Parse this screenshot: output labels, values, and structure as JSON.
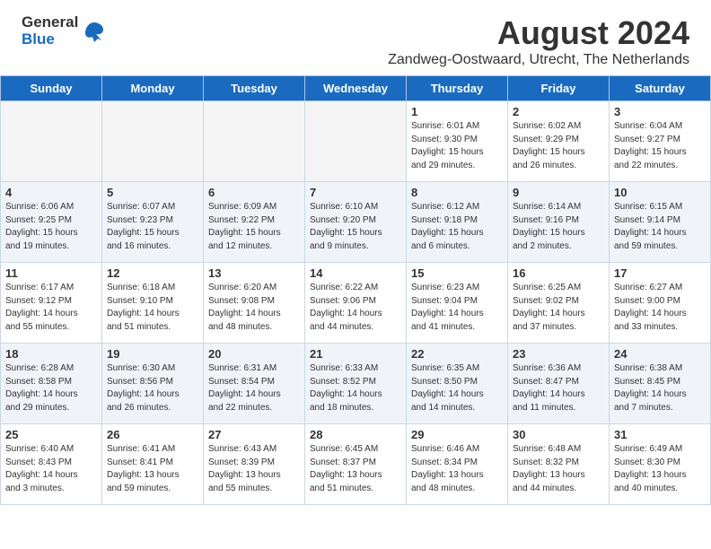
{
  "logo": {
    "general": "General",
    "blue": "Blue"
  },
  "title": "August 2024",
  "subtitle": "Zandweg-Oostwaard, Utrecht, The Netherlands",
  "weekdays": [
    "Sunday",
    "Monday",
    "Tuesday",
    "Wednesday",
    "Thursday",
    "Friday",
    "Saturday"
  ],
  "weeks": [
    [
      {
        "day": "",
        "info": ""
      },
      {
        "day": "",
        "info": ""
      },
      {
        "day": "",
        "info": ""
      },
      {
        "day": "",
        "info": ""
      },
      {
        "day": "1",
        "info": "Sunrise: 6:01 AM\nSunset: 9:30 PM\nDaylight: 15 hours\nand 29 minutes."
      },
      {
        "day": "2",
        "info": "Sunrise: 6:02 AM\nSunset: 9:29 PM\nDaylight: 15 hours\nand 26 minutes."
      },
      {
        "day": "3",
        "info": "Sunrise: 6:04 AM\nSunset: 9:27 PM\nDaylight: 15 hours\nand 22 minutes."
      }
    ],
    [
      {
        "day": "4",
        "info": "Sunrise: 6:06 AM\nSunset: 9:25 PM\nDaylight: 15 hours\nand 19 minutes."
      },
      {
        "day": "5",
        "info": "Sunrise: 6:07 AM\nSunset: 9:23 PM\nDaylight: 15 hours\nand 16 minutes."
      },
      {
        "day": "6",
        "info": "Sunrise: 6:09 AM\nSunset: 9:22 PM\nDaylight: 15 hours\nand 12 minutes."
      },
      {
        "day": "7",
        "info": "Sunrise: 6:10 AM\nSunset: 9:20 PM\nDaylight: 15 hours\nand 9 minutes."
      },
      {
        "day": "8",
        "info": "Sunrise: 6:12 AM\nSunset: 9:18 PM\nDaylight: 15 hours\nand 6 minutes."
      },
      {
        "day": "9",
        "info": "Sunrise: 6:14 AM\nSunset: 9:16 PM\nDaylight: 15 hours\nand 2 minutes."
      },
      {
        "day": "10",
        "info": "Sunrise: 6:15 AM\nSunset: 9:14 PM\nDaylight: 14 hours\nand 59 minutes."
      }
    ],
    [
      {
        "day": "11",
        "info": "Sunrise: 6:17 AM\nSunset: 9:12 PM\nDaylight: 14 hours\nand 55 minutes."
      },
      {
        "day": "12",
        "info": "Sunrise: 6:18 AM\nSunset: 9:10 PM\nDaylight: 14 hours\nand 51 minutes."
      },
      {
        "day": "13",
        "info": "Sunrise: 6:20 AM\nSunset: 9:08 PM\nDaylight: 14 hours\nand 48 minutes."
      },
      {
        "day": "14",
        "info": "Sunrise: 6:22 AM\nSunset: 9:06 PM\nDaylight: 14 hours\nand 44 minutes."
      },
      {
        "day": "15",
        "info": "Sunrise: 6:23 AM\nSunset: 9:04 PM\nDaylight: 14 hours\nand 41 minutes."
      },
      {
        "day": "16",
        "info": "Sunrise: 6:25 AM\nSunset: 9:02 PM\nDaylight: 14 hours\nand 37 minutes."
      },
      {
        "day": "17",
        "info": "Sunrise: 6:27 AM\nSunset: 9:00 PM\nDaylight: 14 hours\nand 33 minutes."
      }
    ],
    [
      {
        "day": "18",
        "info": "Sunrise: 6:28 AM\nSunset: 8:58 PM\nDaylight: 14 hours\nand 29 minutes."
      },
      {
        "day": "19",
        "info": "Sunrise: 6:30 AM\nSunset: 8:56 PM\nDaylight: 14 hours\nand 26 minutes."
      },
      {
        "day": "20",
        "info": "Sunrise: 6:31 AM\nSunset: 8:54 PM\nDaylight: 14 hours\nand 22 minutes."
      },
      {
        "day": "21",
        "info": "Sunrise: 6:33 AM\nSunset: 8:52 PM\nDaylight: 14 hours\nand 18 minutes."
      },
      {
        "day": "22",
        "info": "Sunrise: 6:35 AM\nSunset: 8:50 PM\nDaylight: 14 hours\nand 14 minutes."
      },
      {
        "day": "23",
        "info": "Sunrise: 6:36 AM\nSunset: 8:47 PM\nDaylight: 14 hours\nand 11 minutes."
      },
      {
        "day": "24",
        "info": "Sunrise: 6:38 AM\nSunset: 8:45 PM\nDaylight: 14 hours\nand 7 minutes."
      }
    ],
    [
      {
        "day": "25",
        "info": "Sunrise: 6:40 AM\nSunset: 8:43 PM\nDaylight: 14 hours\nand 3 minutes."
      },
      {
        "day": "26",
        "info": "Sunrise: 6:41 AM\nSunset: 8:41 PM\nDaylight: 13 hours\nand 59 minutes."
      },
      {
        "day": "27",
        "info": "Sunrise: 6:43 AM\nSunset: 8:39 PM\nDaylight: 13 hours\nand 55 minutes."
      },
      {
        "day": "28",
        "info": "Sunrise: 6:45 AM\nSunset: 8:37 PM\nDaylight: 13 hours\nand 51 minutes."
      },
      {
        "day": "29",
        "info": "Sunrise: 6:46 AM\nSunset: 8:34 PM\nDaylight: 13 hours\nand 48 minutes."
      },
      {
        "day": "30",
        "info": "Sunrise: 6:48 AM\nSunset: 8:32 PM\nDaylight: 13 hours\nand 44 minutes."
      },
      {
        "day": "31",
        "info": "Sunrise: 6:49 AM\nSunset: 8:30 PM\nDaylight: 13 hours\nand 40 minutes."
      }
    ]
  ]
}
